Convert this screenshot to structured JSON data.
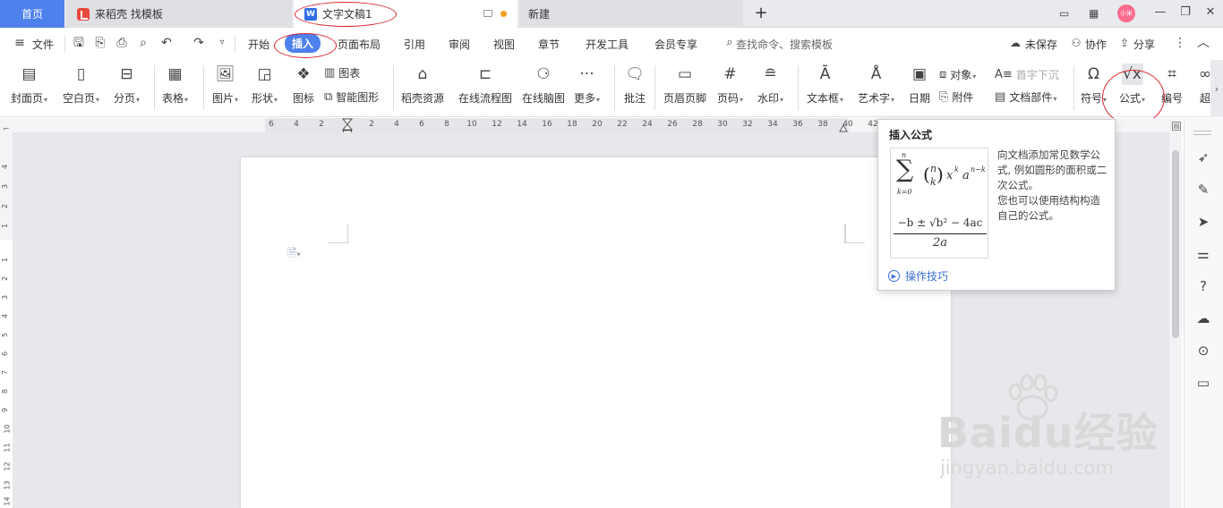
{
  "tabs": {
    "home": "首页",
    "daoke": "来稻壳 找模板",
    "doc": "文字文稿1",
    "new": "新建",
    "plus": "+"
  },
  "user": {
    "avatar": "小米"
  },
  "menu": {
    "file": "文件",
    "start": "开始",
    "insert": "插入",
    "layout": "页面布局",
    "reference": "引用",
    "review": "审阅",
    "view": "视图",
    "section": "章节",
    "devtools": "开发工具",
    "member": "会员专享",
    "search": "查找命令、搜索模板",
    "unsaved": "未保存",
    "collab": "协作",
    "share": "分享"
  },
  "ribbon": {
    "cover": "封面页",
    "blank": "空白页",
    "pagebreak": "分页",
    "table": "表格",
    "picture": "图片",
    "shape": "形状",
    "icon": "图标",
    "chart": "图表",
    "smartart": "智能图形",
    "resources": "稻壳资源",
    "flowchart": "在线流程图",
    "mindmap": "在线脑图",
    "more": "更多",
    "comment": "批注",
    "header_footer": "页眉页脚",
    "page_number": "页码",
    "watermark": "水印",
    "textbox": "文本框",
    "wordart": "艺术字",
    "date": "日期",
    "object": "对象",
    "attachment": "附件",
    "dropcap": "首字下沉",
    "docparts": "文档部件",
    "symbol": "符号",
    "formula": "公式",
    "numbering": "编号",
    "extra": "超"
  },
  "ruler": {
    "h": [
      "6",
      "4",
      "2",
      "2",
      "4",
      "6",
      "8",
      "10",
      "12",
      "14",
      "16",
      "18",
      "20",
      "22",
      "24",
      "26",
      "28",
      "30",
      "32",
      "34",
      "36",
      "38",
      "40",
      "42"
    ],
    "v": [
      "4",
      "3",
      "2",
      "1",
      "1",
      "2",
      "3",
      "4",
      "5",
      "6",
      "7",
      "8",
      "9",
      "10",
      "11",
      "12",
      "13",
      "14"
    ]
  },
  "popup": {
    "title": "插入公式",
    "desc1": "向文档添加常见数学公式, 例如圆形的面积或二次公式。",
    "desc2": "您也可以使用结构构造自己的公式。",
    "link": "操作技巧",
    "f_n": "n",
    "f_sum": "∑",
    "f_k0": "k=0",
    "f_nk_top": "n",
    "f_nk_bot": "k",
    "f_x": "x",
    "f_xexp": "k",
    "f_a": "a",
    "f_aexp": "n−k",
    "f_num": "−b ± √b² − 4ac",
    "f_den": "2a"
  },
  "watermark": {
    "brand": "Baidu经验",
    "url": "jingyan.baidu.com"
  }
}
